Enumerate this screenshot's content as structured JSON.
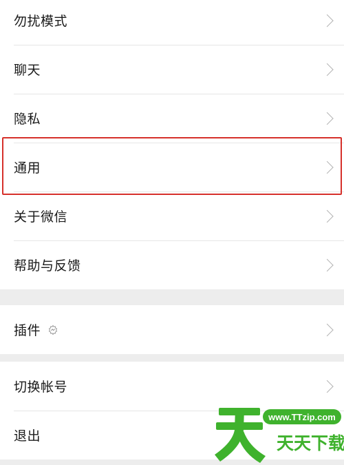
{
  "group1": {
    "items": [
      {
        "label": "勿扰模式"
      },
      {
        "label": "聊天"
      },
      {
        "label": "隐私"
      },
      {
        "label": "通用"
      },
      {
        "label": "关于微信"
      },
      {
        "label": "帮助与反馈"
      }
    ]
  },
  "group2": {
    "items": [
      {
        "label": "插件"
      }
    ]
  },
  "group3": {
    "items": [
      {
        "label": "切换帐号"
      },
      {
        "label": "退出"
      }
    ]
  },
  "watermark": {
    "url_text": "www.TTzip.com",
    "brand_text": "天天下载"
  },
  "colors": {
    "highlight": "#d6302a",
    "watermark_green": "#3fb22d"
  }
}
